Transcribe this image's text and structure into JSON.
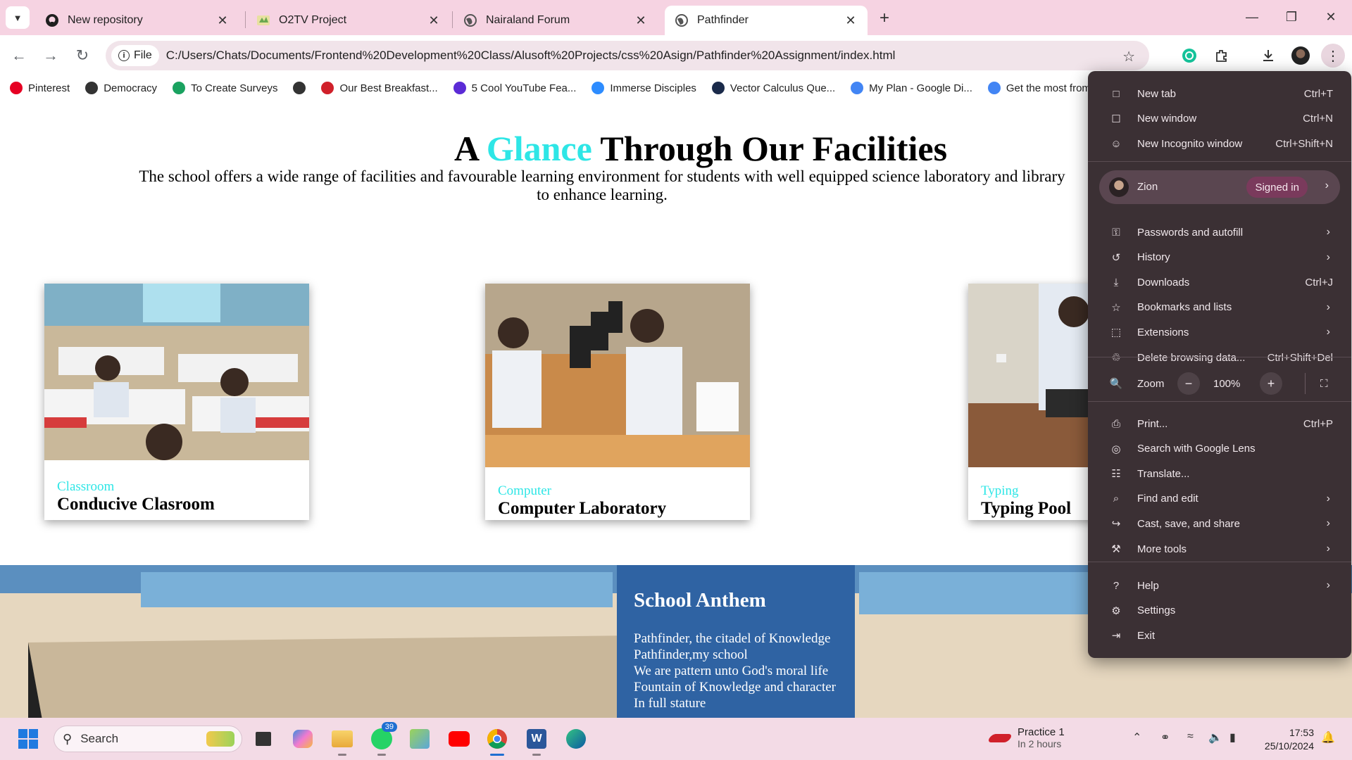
{
  "browser": {
    "tabs": [
      {
        "title": "New repository",
        "icon": "github-icon",
        "active": false
      },
      {
        "title": "O2TV Project",
        "icon": "o2tv-icon",
        "active": false
      },
      {
        "title": "Nairaland Forum",
        "icon": "globe-icon",
        "active": false
      },
      {
        "title": "Pathfinder",
        "icon": "globe-icon",
        "active": true
      }
    ],
    "omnibox": {
      "chip": "File",
      "url": "C:/Users/Chats/Documents/Frontend%20Development%20Class/Alusoft%20Projects/css%20Asign/Pathfinder%20Assignment/index.html"
    },
    "bookmarks": [
      {
        "label": "Pinterest",
        "color": "#e60023",
        "icon": "pinterest-icon"
      },
      {
        "label": "Democracy",
        "color": "#333333",
        "icon": "globe-icon"
      },
      {
        "label": "To Create Surveys",
        "color": "#1aa260",
        "icon": "survey-icon"
      },
      {
        "label": "",
        "color": "#333333",
        "icon": "globe-icon"
      },
      {
        "label": "Our Best Breakfast...",
        "color": "#d0202a",
        "icon": "food-icon"
      },
      {
        "label": "5 Cool YouTube Fea...",
        "color": "#5b2bd6",
        "icon": "gt-icon"
      },
      {
        "label": "Immerse Disciples",
        "color": "#2d8cff",
        "icon": "zoom-icon"
      },
      {
        "label": "Vector Calculus Que...",
        "color": "#1a2a4a",
        "icon": "doc-icon"
      },
      {
        "label": "My Plan - Google Di...",
        "color": "#4285f4",
        "icon": "google-icon"
      },
      {
        "label": "Get the most from y",
        "color": "#4285f4",
        "icon": "google-icon"
      }
    ]
  },
  "page": {
    "heading": {
      "pre": "A ",
      "highlight": "Glance",
      "post": " Through Our Facilities"
    },
    "intro": "The school offers a wide range of facilities and favourable learning environment for students with well equipped science laboratory and library to enhance learning.",
    "cards": [
      {
        "category": "Classroom",
        "title": "Conducive Clasroom"
      },
      {
        "category": "Computer",
        "title": "Computer Laboratory"
      },
      {
        "category": "Typing",
        "title": "Typing Pool"
      }
    ],
    "anthem": {
      "title": "School Anthem",
      "lines": [
        "Pathfinder, the citadel of Knowledge",
        "Pathfinder,my school",
        "We are pattern unto God's moral life",
        "Fountain of Knowledge and character",
        "In full stature"
      ]
    }
  },
  "menu": {
    "items_top": [
      {
        "label": "New tab",
        "shortcut": "Ctrl+T",
        "icon": "new-tab-icon"
      },
      {
        "label": "New window",
        "shortcut": "Ctrl+N",
        "icon": "new-window-icon"
      },
      {
        "label": "New Incognito window",
        "shortcut": "Ctrl+Shift+N",
        "icon": "incognito-icon"
      }
    ],
    "profile": {
      "name": "Zion",
      "status": "Signed in"
    },
    "items_mid": [
      {
        "label": "Passwords and autofill",
        "shortcut": "",
        "arrow": true,
        "icon": "key-icon"
      },
      {
        "label": "History",
        "shortcut": "",
        "arrow": true,
        "icon": "history-icon"
      },
      {
        "label": "Downloads",
        "shortcut": "Ctrl+J",
        "arrow": false,
        "icon": "download-icon"
      },
      {
        "label": "Bookmarks and lists",
        "shortcut": "",
        "arrow": true,
        "icon": "star-icon"
      },
      {
        "label": "Extensions",
        "shortcut": "",
        "arrow": true,
        "icon": "extensions-icon"
      },
      {
        "label": "Delete browsing data...",
        "shortcut": "Ctrl+Shift+Del",
        "arrow": false,
        "icon": "trash-icon"
      }
    ],
    "zoom": {
      "label": "Zoom",
      "value": "100%",
      "minus": "−",
      "plus": "+"
    },
    "items_tools": [
      {
        "label": "Print...",
        "shortcut": "Ctrl+P",
        "arrow": false,
        "icon": "print-icon"
      },
      {
        "label": "Search with Google Lens",
        "shortcut": "",
        "arrow": false,
        "icon": "lens-icon"
      },
      {
        "label": "Translate...",
        "shortcut": "",
        "arrow": false,
        "icon": "translate-icon"
      },
      {
        "label": "Find and edit",
        "shortcut": "",
        "arrow": true,
        "icon": "find-icon"
      },
      {
        "label": "Cast, save, and share",
        "shortcut": "",
        "arrow": true,
        "icon": "cast-icon"
      },
      {
        "label": "More tools",
        "shortcut": "",
        "arrow": true,
        "icon": "toolbox-icon"
      }
    ],
    "items_bottom": [
      {
        "label": "Help",
        "shortcut": "",
        "arrow": true,
        "icon": "help-icon"
      },
      {
        "label": "Settings",
        "shortcut": "",
        "arrow": false,
        "icon": "settings-icon"
      },
      {
        "label": "Exit",
        "shortcut": "",
        "arrow": false,
        "icon": "exit-icon"
      }
    ]
  },
  "taskbar": {
    "search_placeholder": "Search",
    "whatsapp_badge": "39",
    "notification": {
      "title": "Practice 1",
      "subtitle": "In 2 hours"
    },
    "time": "17:53",
    "date": "25/10/2024"
  }
}
